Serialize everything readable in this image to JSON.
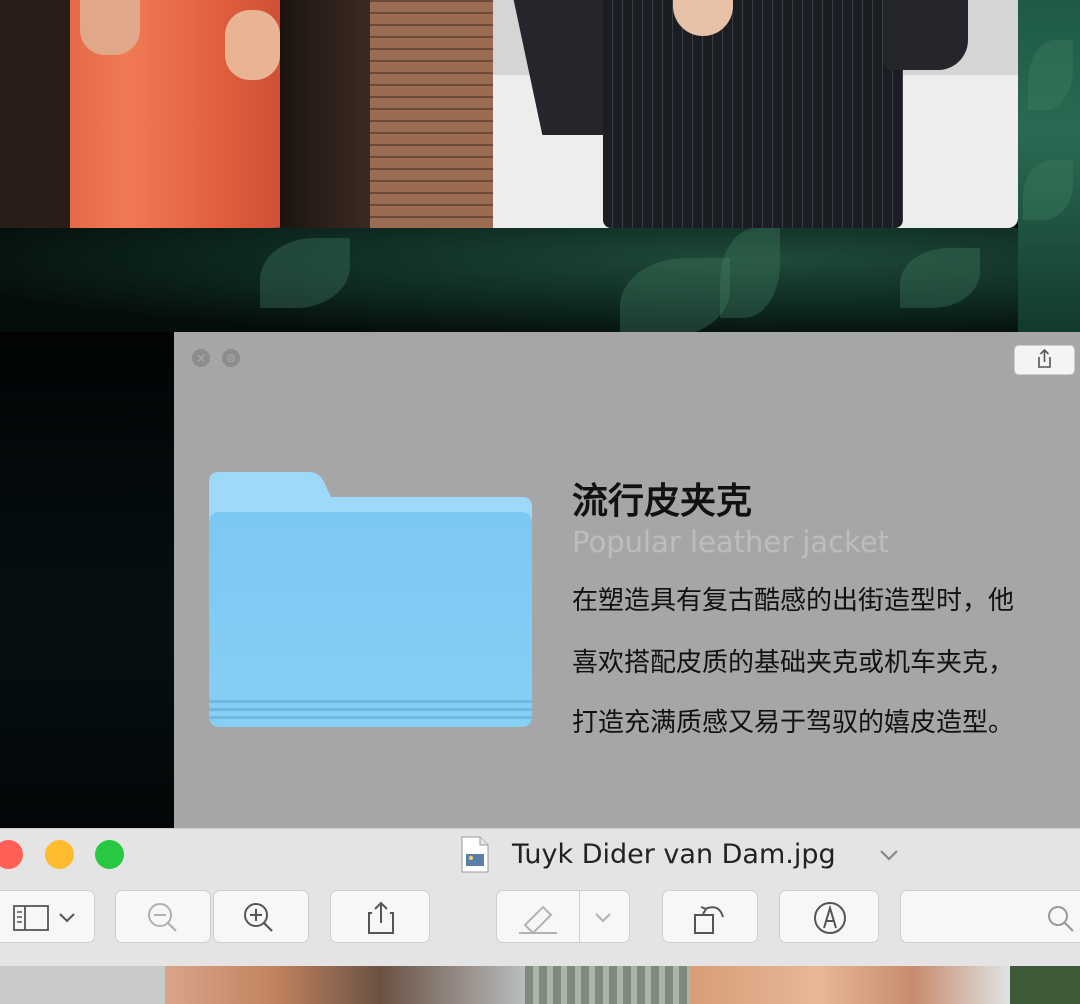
{
  "info_window": {
    "title": "流行皮夹克",
    "subtitle": "Popular leather jacket",
    "body_lines": [
      "在塑造具有复古酷感的出街造型时，他",
      "喜欢搭配皮质的基础夹克或机车夹克，",
      "打造充满质感又易于驾驭的嬉皮造型。"
    ],
    "close_glyph": "×",
    "minimize_glyph": "⊘",
    "folder_color": "#82c9f2"
  },
  "preview_window": {
    "filename": "Tuyk Dider van Dam.jpg",
    "traffic_colors": {
      "close": "#fe5f57",
      "minimize": "#febc2e",
      "zoom": "#28c840"
    },
    "toolbar_icons": [
      "sidebar-icon",
      "chevron-down-icon",
      "zoom-out-icon",
      "zoom-in-icon",
      "share-icon",
      "highlight-pen-icon",
      "chevron-down-icon",
      "rotate-icon",
      "markup-icon",
      "search-icon"
    ]
  }
}
